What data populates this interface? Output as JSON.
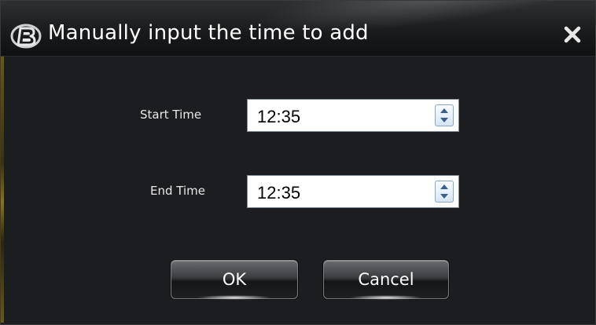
{
  "window": {
    "title": "Manually input the time to add",
    "logo_letter": "B",
    "close_glyph": "×",
    "icons": {
      "logo": "app-logo-icon",
      "close": "close-icon"
    },
    "colors": {
      "background": "#1c1d20",
      "title_text": "#ffffff",
      "label_text": "#e8e8e8"
    }
  },
  "form": {
    "start": {
      "label": "Start Time",
      "value": "12:35"
    },
    "end": {
      "label": "End Time",
      "value": "12:35"
    }
  },
  "buttons": {
    "ok_label": "OK",
    "cancel_label": "Cancel"
  }
}
